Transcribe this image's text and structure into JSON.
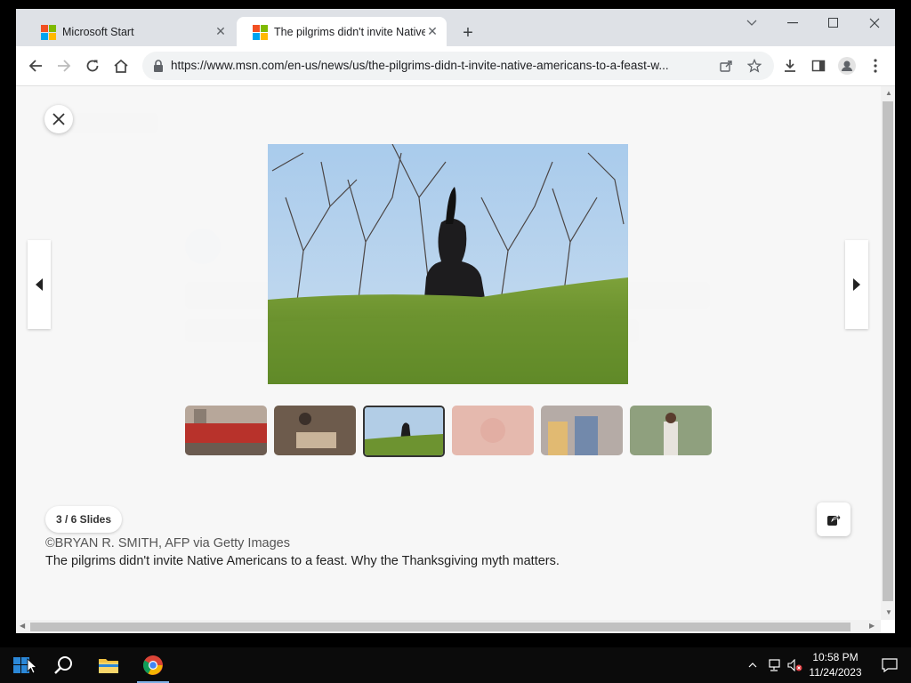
{
  "browser": {
    "tabs": [
      {
        "title": "Microsoft Start",
        "active": false
      },
      {
        "title": "The pilgrims didn't invite Native",
        "active": true
      }
    ],
    "url": "https://www.msn.com/en-us/news/us/the-pilgrims-didn-t-invite-native-americans-to-a-feast-w..."
  },
  "slideshow": {
    "counter": "3 / 6 Slides",
    "credit": "©BRYAN R. SMITH, AFP via Getty Images",
    "caption": "The pilgrims didn't invite Native Americans to a feast. Why the Thanksgiving myth matters.",
    "current_index": 3,
    "total": 6
  },
  "taskbar": {
    "time": "10:58 PM",
    "date": "11/24/2023"
  },
  "colors": {
    "ms_red": "#f25022",
    "ms_green": "#7fba00",
    "ms_blue": "#00a4ef",
    "ms_yellow": "#ffb900",
    "tabstrip": "#dee1e6",
    "taskbar": "#0b0b0b"
  }
}
